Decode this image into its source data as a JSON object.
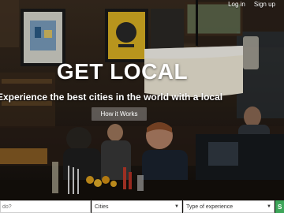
{
  "nav": {
    "login_label": "Log in",
    "signup_label": "Sign up"
  },
  "hero": {
    "title": "GET LOCAL",
    "subtitle": "Experience the best cities in the world with a local",
    "how_it_works_label": "How it Works"
  },
  "search": {
    "keyword_placeholder": "do?",
    "cities_label": "Cities",
    "experience_label": "Type of experience",
    "search_button_label": "S"
  },
  "colors": {
    "search_button": "#3ea65a",
    "overlay_text": "#ffffff"
  }
}
